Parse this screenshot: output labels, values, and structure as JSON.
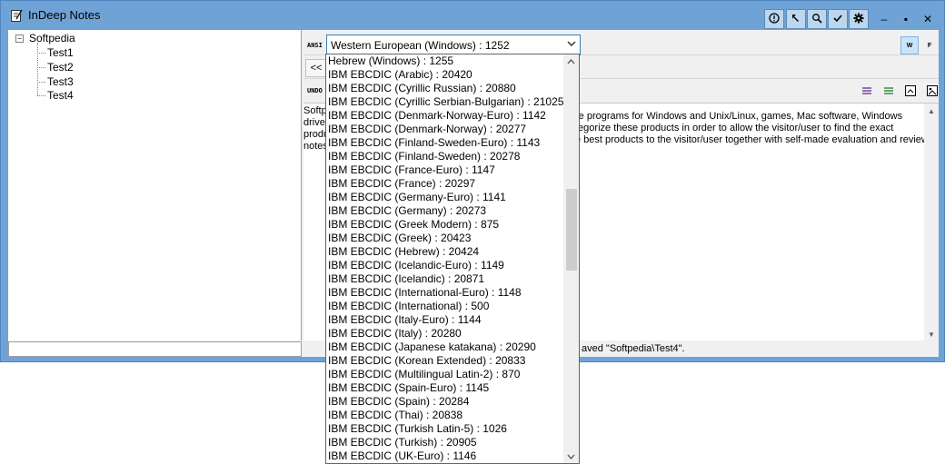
{
  "window": {
    "title": "InDeep Notes"
  },
  "toolbar": {
    "buttons": [
      "info-icon",
      "pointer-icon",
      "search-icon",
      "check-icon",
      "gear-icon"
    ],
    "window_controls": {
      "minimize": "–",
      "maximize": "▪",
      "close": "✕"
    }
  },
  "tree": {
    "root": "Softpedia",
    "expander": "−",
    "children": [
      "Test1",
      "Test2",
      "Test3",
      "Test4"
    ]
  },
  "encoding_bar": {
    "label": "ANSI",
    "selected": "Western European (Windows) : 1252",
    "w_button": "W",
    "f_button": "F"
  },
  "nav": {
    "back_label": "<<"
  },
  "format_bar": {
    "undo_label": "UNDO"
  },
  "editor": {
    "lines": [
      "Softp",
      "driver",
      "produ",
      "notes"
    ],
    "right_lines": [
      "re programs for Windows and Unix/Linux, games, Mac software, Windows",
      "tegorize these products in order to allow the visitor/user to find the exact",
      "e best products to the visitor/user together with self-made evaluation and review"
    ]
  },
  "status": {
    "text": "aved \"Softpedia\\Test4\"."
  },
  "dropdown": {
    "items": [
      "Hebrew (Windows) : 1255",
      "IBM EBCDIC (Arabic) : 20420",
      "IBM EBCDIC (Cyrillic Russian) : 20880",
      "IBM EBCDIC (Cyrillic Serbian-Bulgarian) : 21025",
      "IBM EBCDIC (Denmark-Norway-Euro) : 1142",
      "IBM EBCDIC (Denmark-Norway) : 20277",
      "IBM EBCDIC (Finland-Sweden-Euro) : 1143",
      "IBM EBCDIC (Finland-Sweden) : 20278",
      "IBM EBCDIC (France-Euro) : 1147",
      "IBM EBCDIC (France) : 20297",
      "IBM EBCDIC (Germany-Euro) : 1141",
      "IBM EBCDIC (Germany) : 20273",
      "IBM EBCDIC (Greek Modern) : 875",
      "IBM EBCDIC (Greek) : 20423",
      "IBM EBCDIC (Hebrew) : 20424",
      "IBM EBCDIC (Icelandic-Euro) : 1149",
      "IBM EBCDIC (Icelandic) : 20871",
      "IBM EBCDIC (International-Euro) : 1148",
      "IBM EBCDIC (International) : 500",
      "IBM EBCDIC (Italy-Euro) : 1144",
      "IBM EBCDIC (Italy) : 20280",
      "IBM EBCDIC (Japanese katakana) : 20290",
      "IBM EBCDIC (Korean Extended) : 20833",
      "IBM EBCDIC (Multilingual Latin-2) : 870",
      "IBM EBCDIC (Spain-Euro) : 1145",
      "IBM EBCDIC (Spain) : 20284",
      "IBM EBCDIC (Thai) : 20838",
      "IBM EBCDIC (Turkish Latin-5) : 1026",
      "IBM EBCDIC (Turkish) : 20905",
      "IBM EBCDIC (UK-Euro) : 1146"
    ]
  },
  "colors": {
    "frame": "#6fa3d6",
    "accent": "#3c7fb1"
  }
}
